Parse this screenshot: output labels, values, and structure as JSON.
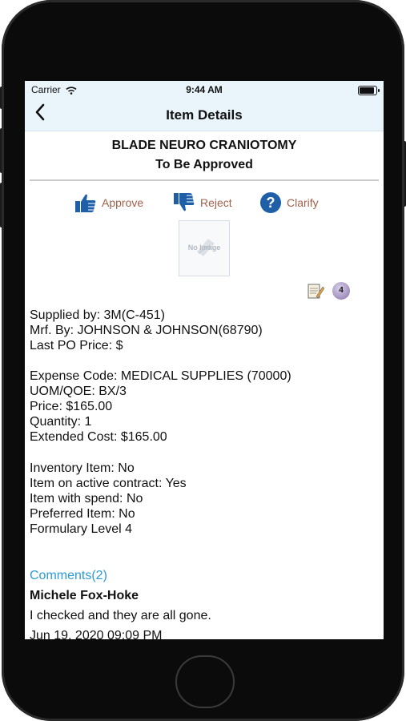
{
  "status_bar": {
    "carrier": "Carrier",
    "time": "9:44 AM",
    "battery_level": 0.9
  },
  "nav": {
    "back_icon": "chevron-left",
    "title": "Item Details"
  },
  "item": {
    "name": "BLADE NEURO CRANIOTOMY",
    "status": "To Be Approved"
  },
  "actions": [
    {
      "label": "Approve",
      "icon": "thumbs-up-icon",
      "color": "#1f5fa8"
    },
    {
      "label": "Reject",
      "icon": "thumbs-down-icon",
      "color": "#1f5fa8"
    },
    {
      "label": "Clarify",
      "icon": "question-circle-icon",
      "color": "#1f5fa8"
    }
  ],
  "image": {
    "placeholder_text": "No Image"
  },
  "notes": {
    "count": "4"
  },
  "supplier_info": [
    "Supplied by: 3M(C-451)",
    "Mrf. By: JOHNSON & JOHNSON(68790)",
    "Last PO Price: $"
  ],
  "pricing_info": [
    "Expense Code: MEDICAL SUPPLIES (70000)",
    "UOM/QOE: BX/3",
    "Price: $165.00",
    "Quantity: 1",
    "Extended Cost: $165.00"
  ],
  "flags_info": [
    "Inventory Item: No",
    "Item on active contract: Yes",
    "Item with spend: No",
    "Preferred Item: No",
    "Formulary Level 4"
  ],
  "comments": {
    "link_label": "Comments(2)",
    "author": "Michele Fox-Hoke",
    "text": "I checked and they are all gone.",
    "date": "Jun 19, 2020 09:09 PM"
  },
  "colors": {
    "accent": "#1f5fa8",
    "action_text": "#a0614c",
    "link": "#2b9ad6",
    "nav_bg": "#e9f4fb"
  }
}
